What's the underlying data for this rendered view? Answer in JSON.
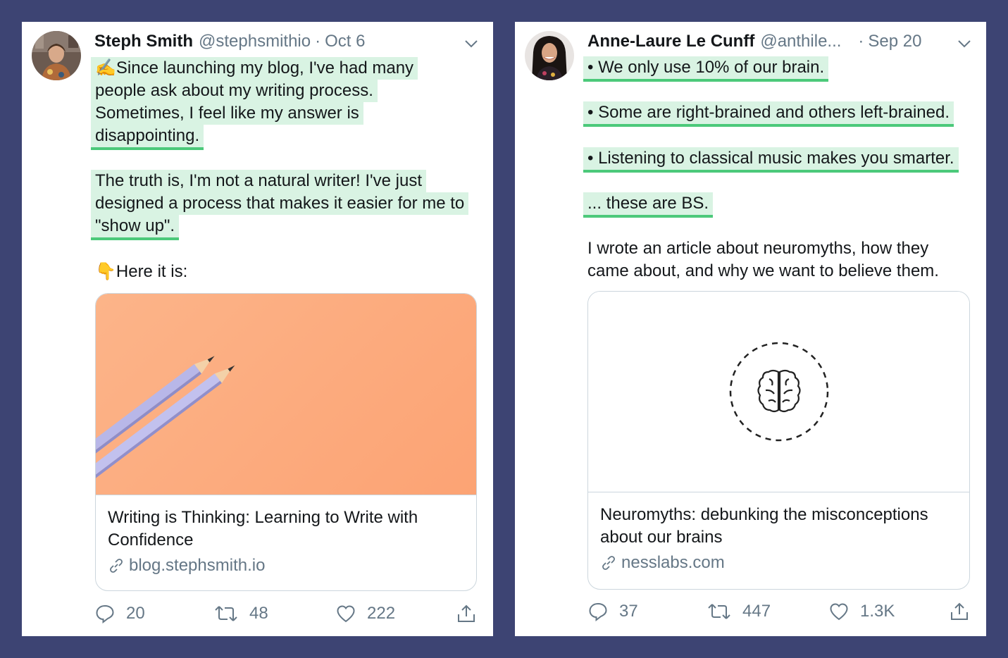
{
  "tweets": [
    {
      "name": "Steph Smith",
      "handle": "@stephsmithio",
      "separator": "·",
      "date": "Oct 6",
      "lines": [
        "✍️Since launching my blog, I've had many",
        "people ask about my writing process.",
        "Sometimes, I feel like my answer is",
        "disappointing.",
        "The truth is, I'm not a natural writer! I've just",
        "designed a process that makes it easier for me to",
        "\"show up\"."
      ],
      "here_text": "👇Here it is:",
      "card": {
        "title_line1": "Writing is Thinking: Learning to Write with",
        "title_line2": "Confidence",
        "domain": "blog.stephsmith.io"
      },
      "stats": {
        "replies": "20",
        "retweets": "48",
        "likes": "222"
      }
    },
    {
      "name": "Anne-Laure Le Cunff",
      "handle": "@anthile...",
      "separator": "·",
      "date": "Sep 20",
      "bullets": [
        "• We only use 10% of our brain.",
        "• Some are right-brained and others left-brained.",
        "• Listening to classical music makes you smarter.",
        "... these are BS."
      ],
      "body_line1": "I wrote an article about neuromyths, how they",
      "body_line2": "came about, and why we want to believe them.",
      "card": {
        "title_line1": "Neuromyths: debunking the misconceptions",
        "title_line2": "about our brains",
        "domain": "nesslabs.com"
      },
      "stats": {
        "replies": "37",
        "retweets": "447",
        "likes": "1.3K"
      }
    }
  ],
  "colors": {
    "background": "#3d4473",
    "highlight": "#d9f3e3",
    "underline": "#4cc97a",
    "card_image": "#fcab7e"
  },
  "icons": [
    "chevron-down-icon",
    "reply-icon",
    "retweet-icon",
    "like-icon",
    "share-icon",
    "link-icon",
    "brain-icon"
  ]
}
